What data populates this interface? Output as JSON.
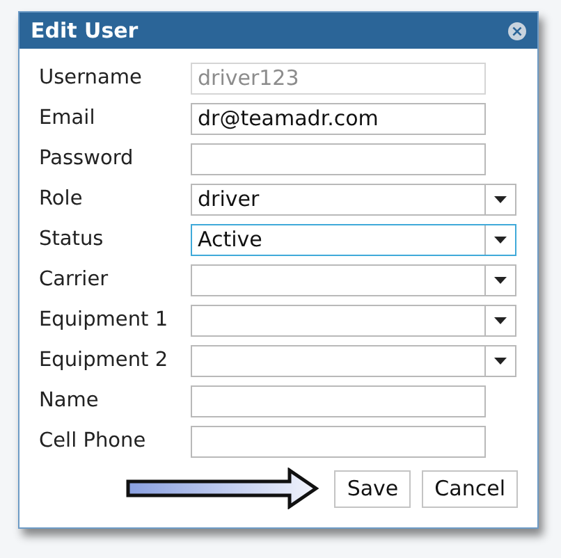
{
  "dialog": {
    "title": "Edit User",
    "close_icon": "×"
  },
  "fields": [
    {
      "label": "Username",
      "kind": "text",
      "value": "driver123",
      "disabled": true,
      "focused": false
    },
    {
      "label": "Email",
      "kind": "text",
      "value": "dr@teamadr.com",
      "disabled": false,
      "focused": false
    },
    {
      "label": "Password",
      "kind": "text",
      "disabled": false,
      "focused": false
    },
    {
      "label": "Role",
      "kind": "select",
      "value": "driver",
      "disabled": false,
      "focused": false
    },
    {
      "label": "Status",
      "kind": "select",
      "value": "Active",
      "disabled": false,
      "focused": true
    },
    {
      "label": "Carrier",
      "kind": "select",
      "disabled": false,
      "focused": false
    },
    {
      "label": "Equipment 1",
      "kind": "select",
      "disabled": false,
      "focused": false
    },
    {
      "label": "Equipment 2",
      "kind": "select",
      "disabled": false,
      "focused": false
    },
    {
      "label": "Name",
      "kind": "text",
      "disabled": false,
      "focused": false
    },
    {
      "label": "Cell Phone",
      "kind": "text",
      "disabled": false,
      "focused": false
    }
  ],
  "buttons": [
    "Save",
    "Cancel"
  ]
}
